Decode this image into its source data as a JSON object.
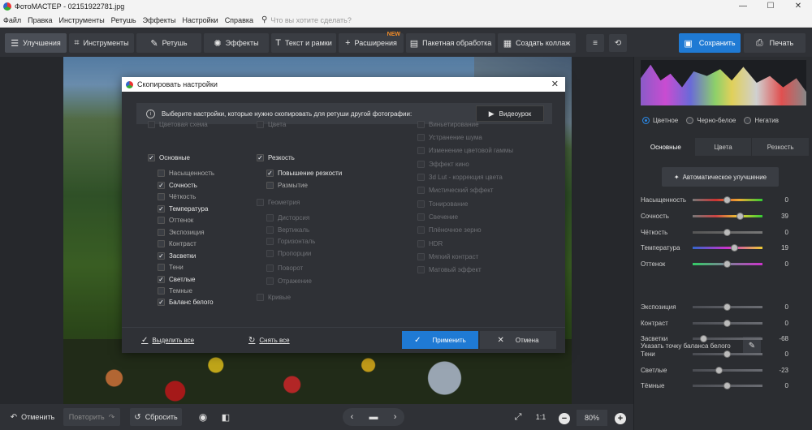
{
  "window": {
    "title": "ФотоМАСТЕР - 02151922781.jpg",
    "minimize": "—",
    "maximize": "☐",
    "close": "✕"
  },
  "menu": {
    "items": [
      "Файл",
      "Правка",
      "Инструменты",
      "Ретушь",
      "Эффекты",
      "Настройки",
      "Справка"
    ],
    "search_placeholder": "Что вы хотите сделать?"
  },
  "toolbar": {
    "tabs": [
      {
        "label": "Улучшения",
        "icon": "sliders-icon"
      },
      {
        "label": "Инструменты",
        "icon": "crop-icon"
      },
      {
        "label": "Ретушь",
        "icon": "brush-icon"
      },
      {
        "label": "Эффекты",
        "icon": "sparkle-icon"
      },
      {
        "label": "Текст и рамки",
        "icon": "text-icon"
      },
      {
        "label": "Расширения",
        "icon": "plus-icon",
        "badge": "NEW"
      },
      {
        "label": "Пакетная обработка",
        "icon": "batch-icon"
      },
      {
        "label": "Создать коллаж",
        "icon": "collage-icon"
      }
    ],
    "save": "Сохранить",
    "print": "Печать"
  },
  "dialog": {
    "title": "Скопировать настройки",
    "info": "Выберите настройки, которые нужно скопировать для ретуши другой фотографии:",
    "video": "Видеоурок",
    "col1": [
      {
        "label": "Цветовая схема",
        "checked": false,
        "dim": true
      },
      {
        "label": "Основные",
        "checked": true,
        "dim": false
      },
      {
        "label": "Насыщенность",
        "checked": false,
        "dim": false
      },
      {
        "label": "Сочность",
        "checked": true,
        "dim": false
      },
      {
        "label": "Чёткость",
        "checked": false,
        "dim": false
      },
      {
        "label": "Температура",
        "checked": true,
        "dim": false
      },
      {
        "label": "Оттенок",
        "checked": false,
        "dim": false
      },
      {
        "label": "Экспозиция",
        "checked": false,
        "dim": false
      },
      {
        "label": "Контраст",
        "checked": false,
        "dim": false
      },
      {
        "label": "Засветки",
        "checked": true,
        "dim": false
      },
      {
        "label": "Тени",
        "checked": false,
        "dim": false
      },
      {
        "label": "Светлые",
        "checked": true,
        "dim": false
      },
      {
        "label": "Темные",
        "checked": false,
        "dim": false
      },
      {
        "label": "Баланс белого",
        "checked": true,
        "dim": false
      }
    ],
    "col2": [
      {
        "label": "Цвета",
        "checked": false,
        "dim": true
      },
      {
        "label": "Резкость",
        "checked": true,
        "dim": false
      },
      {
        "label": "Повышение резкости",
        "checked": true,
        "dim": false
      },
      {
        "label": "Размытие",
        "checked": false,
        "dim": false
      },
      {
        "label": "Геометрия",
        "checked": false,
        "dim": true
      },
      {
        "label": "Дисторсия",
        "checked": false,
        "dim": true
      },
      {
        "label": "Вертикаль",
        "checked": false,
        "dim": true
      },
      {
        "label": "Горизонталь",
        "checked": false,
        "dim": true
      },
      {
        "label": "Пропорции",
        "checked": false,
        "dim": true
      },
      {
        "label": "Поворот",
        "checked": false,
        "dim": true
      },
      {
        "label": "Отражение",
        "checked": false,
        "dim": true
      },
      {
        "label": "Кривые",
        "checked": false,
        "dim": true
      }
    ],
    "col3": [
      {
        "label": "Виньетирование",
        "checked": false,
        "dim": true
      },
      {
        "label": "Устранение шума",
        "checked": false,
        "dim": true
      },
      {
        "label": "Изменение цветовой гаммы",
        "checked": false,
        "dim": true
      },
      {
        "label": "Эффект кино",
        "checked": false,
        "dim": true
      },
      {
        "label": "3d Lut - коррекция цвета",
        "checked": false,
        "dim": true
      },
      {
        "label": "Мистический эффект",
        "checked": false,
        "dim": true
      },
      {
        "label": "Тонирование",
        "checked": false,
        "dim": true
      },
      {
        "label": "Свечение",
        "checked": false,
        "dim": true
      },
      {
        "label": "Плёночное зерно",
        "checked": false,
        "dim": true
      },
      {
        "label": "HDR",
        "checked": false,
        "dim": true
      },
      {
        "label": "Мягкий контраст",
        "checked": false,
        "dim": true
      },
      {
        "label": "Матовый эффект",
        "checked": false,
        "dim": true
      }
    ],
    "select_all": "Выделить все",
    "deselect_all": "Снять все",
    "apply": "Применить",
    "cancel": "Отмена"
  },
  "right": {
    "modes": [
      {
        "label": "Цветное",
        "on": true
      },
      {
        "label": "Черно-белое",
        "on": false
      },
      {
        "label": "Негатив",
        "on": false
      }
    ],
    "tabs": [
      {
        "label": "Основные",
        "on": true
      },
      {
        "label": "Цвета",
        "on": false
      },
      {
        "label": "Резкость",
        "on": false
      }
    ],
    "auto": "Автоматическое улучшение",
    "sliders_top": [
      {
        "label": "Насыщенность",
        "value": "0",
        "level": 0.5,
        "track": "linear-gradient(90deg,#777,#c33,#ea3,#3c3)"
      },
      {
        "label": "Сочность",
        "value": "39",
        "level": 0.69,
        "track": "linear-gradient(90deg,#777,#c44,#ec3,#3c3)"
      },
      {
        "label": "Чёткость",
        "value": "0",
        "level": 0.5,
        "track": "linear-gradient(90deg,#555,#777)"
      },
      {
        "label": "Температура",
        "value": "19",
        "level": 0.6,
        "track": "linear-gradient(90deg,#36c,#c3c,#ec3)"
      },
      {
        "label": "Оттенок",
        "value": "0",
        "level": 0.5,
        "track": "linear-gradient(90deg,#3c6,#c3c)"
      }
    ],
    "wb_label": "Указать точку баланса белого",
    "sliders_bottom": [
      {
        "label": "Экспозиция",
        "value": "0",
        "level": 0.5
      },
      {
        "label": "Контраст",
        "value": "0",
        "level": 0.5
      },
      {
        "label": "Засветки",
        "value": "-68",
        "level": 0.16
      },
      {
        "label": "Тени",
        "value": "0",
        "level": 0.5
      },
      {
        "label": "Светлые",
        "value": "-23",
        "level": 0.385
      },
      {
        "label": "Тёмные",
        "value": "0",
        "level": 0.5
      }
    ]
  },
  "bottom": {
    "undo": "Отменить",
    "redo": "Повторить",
    "reset": "Сбросить",
    "ratio": "1:1",
    "zoom": "80%"
  }
}
